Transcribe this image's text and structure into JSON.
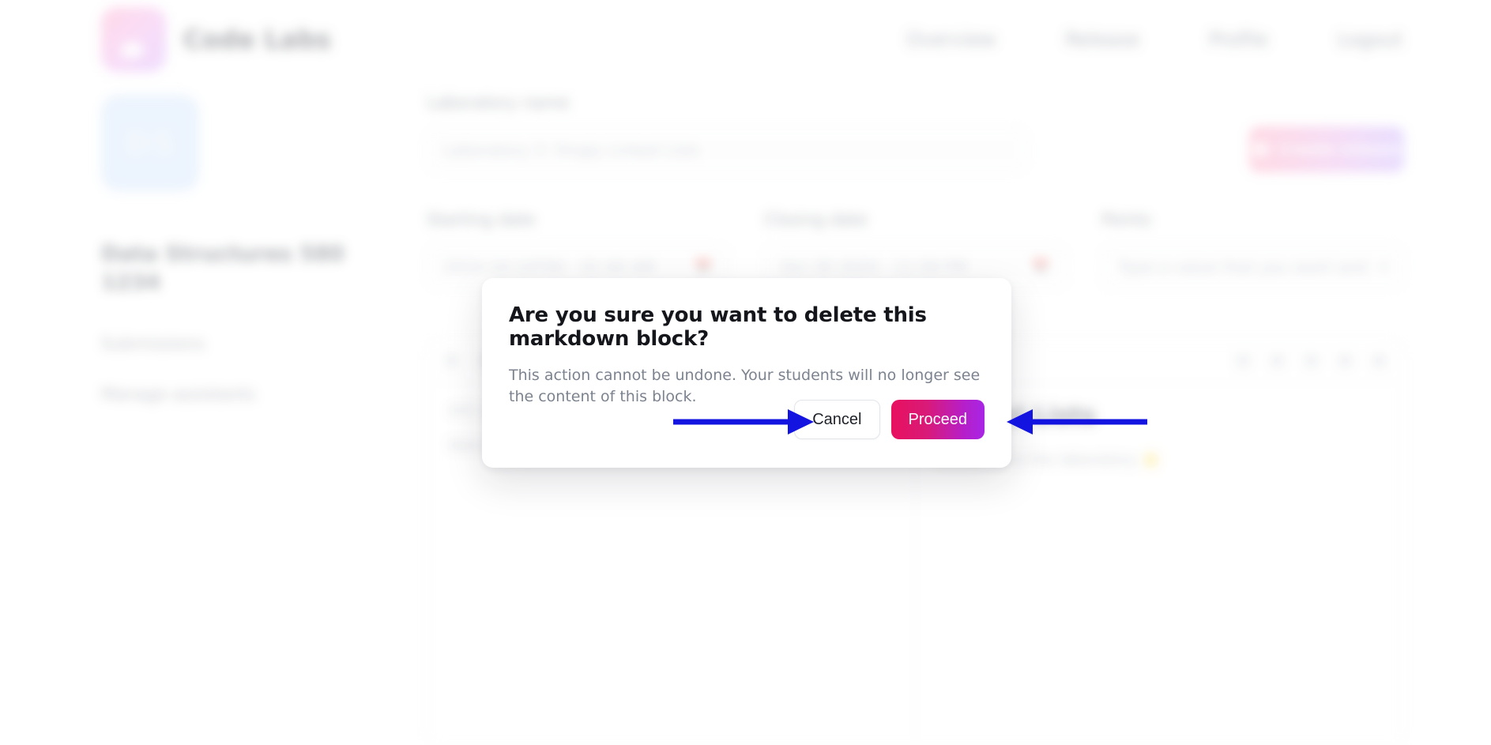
{
  "header": {
    "brand_name": "Code Labs",
    "logo_icon": "gradient-rocket-logo",
    "nav": [
      {
        "label": "Overview"
      },
      {
        "label": "Release"
      },
      {
        "label": "Profile"
      },
      {
        "label": "Logout"
      }
    ]
  },
  "sidebar": {
    "course_badge_text": "DS",
    "course_title": "Data Structures 580 1234",
    "items": [
      {
        "label": "Submissions"
      },
      {
        "label": "Manage assistants"
      }
    ]
  },
  "main": {
    "top_action": {
      "label": "Create release",
      "icon": "rocket-icon"
    },
    "fields": {
      "name_label": "Laboratory name",
      "name_value": "Laboratory 3: Singly Linked Lists",
      "start_label": "Starting date",
      "start_value": "2024-10-14T00 - 01:00 AM",
      "deadline_label": "Closing date",
      "deadline_value": "Oct 30 2024 - 11:59 PM",
      "points_label": "Points",
      "points_value": "Type a value that you want and",
      "calendar_icon": "calendar-icon",
      "chevron_icon": "chevron-down-icon"
    },
    "editor": {
      "toolbar_left_icons": [
        "bold-icon",
        "italic-icon"
      ],
      "toolbar_right_icons": [
        "link-icon",
        "quote-icon",
        "code-icon",
        "image-icon",
        "delete-icon"
      ],
      "markdown_lines": [
        "## Linked Lists",
        "Welcome to the laboratory"
      ],
      "preview_heading": "Linked Lists",
      "preview_paragraph": "Welcome to the laboratory ⭐"
    }
  },
  "dialog": {
    "title": "Are you sure you want to delete this markdown block?",
    "description": "This action cannot be undone. Your students will no longer see the content of this block.",
    "cancel_label": "Cancel",
    "proceed_label": "Proceed"
  },
  "annotations": {
    "arrow_color": "#1414e0",
    "arrow_cancel_target": "Cancel",
    "arrow_proceed_target": "Proceed"
  },
  "colors": {
    "accent_start": "#e8105f",
    "accent_end": "#a726e6",
    "dialog_bg": "#ffffff",
    "text_primary": "#14161c",
    "text_muted": "#7c838f",
    "badge_bg": "#cfe3fc"
  }
}
